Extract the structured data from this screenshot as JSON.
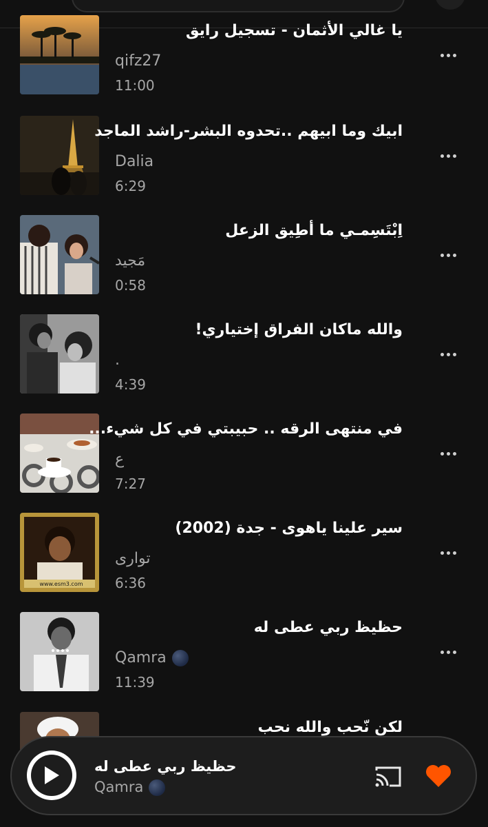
{
  "tracks": [
    {
      "title": "يا غالي الأثمان - تسجيل رايق",
      "artist": "qifz27",
      "duration": "11:00"
    },
    {
      "title": "ابيك وما ابيهم ..تحدوه البشر-راشد الماجد",
      "artist": "Dalia",
      "duration": "6:29"
    },
    {
      "title": "اِبْتَسِمـي ما أطِيق الزعل",
      "artist": "مَجيد",
      "duration": "0:58"
    },
    {
      "title": "والله ماكان الفراق إختياري!",
      "artist": ".",
      "duration": "4:39"
    },
    {
      "title": "في منتهى الرقه .. حبيبتي في كل شيء...",
      "artist": "ع",
      "duration": "7:27"
    },
    {
      "title": "سير علينا ياهوى - جدة (2002)",
      "artist": "توارى",
      "duration": "6:36"
    },
    {
      "title": "حظيظ ربي عطى له",
      "artist": "Qamra",
      "duration": "11:39"
    },
    {
      "title": "لكن نّحب والله نحب",
      "artist": "",
      "duration": ""
    }
  ],
  "thumb_text": {
    "esm3": "www.esm3.com"
  },
  "now_playing": {
    "title": "حظيظ ربي عطى له",
    "artist": "Qamra"
  },
  "icons": {
    "play": "play-icon",
    "cast": "cast-icon",
    "like": "heart-icon",
    "more": "more-icon"
  },
  "colors": {
    "accent": "#ff5500",
    "background": "#111111",
    "secondary_text": "#a7a7a7"
  }
}
